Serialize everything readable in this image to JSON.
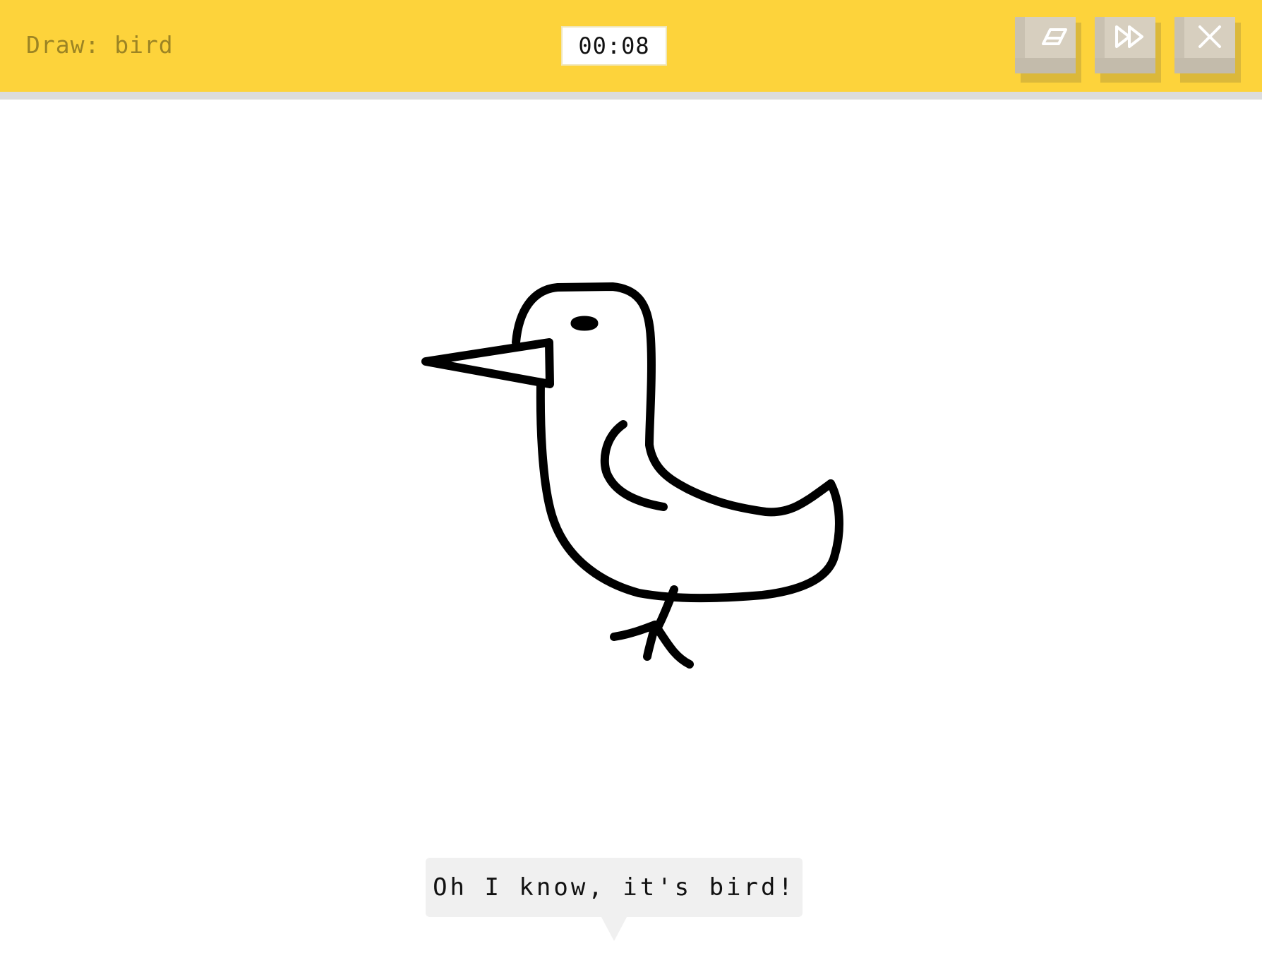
{
  "header": {
    "prompt": "Draw: bird",
    "timer": "00:08",
    "buttons": [
      {
        "name": "clear",
        "icon": "eraser-icon"
      },
      {
        "name": "skip",
        "icon": "fast-forward-icon"
      },
      {
        "name": "close",
        "icon": "close-icon"
      }
    ]
  },
  "canvas": {
    "subject": "bird"
  },
  "speech": {
    "text": "Oh I know, it's bird!"
  },
  "colors": {
    "topbar": "#fdd33b",
    "prompt_text": "#9c8424",
    "key_face": "#d7cfbf",
    "ink": "#000000",
    "bubble": "#f0f0f0"
  }
}
